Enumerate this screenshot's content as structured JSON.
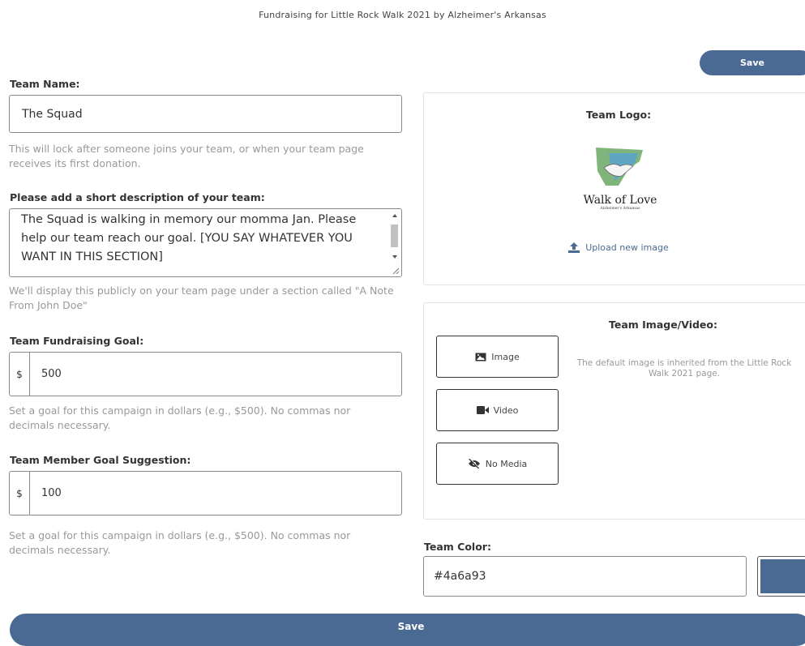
{
  "header": {
    "title": "Fundraising for Little Rock Walk 2021 by Alzheimer's Arkansas"
  },
  "actions": {
    "save_top": "Save",
    "save_bottom": "Save"
  },
  "team_name": {
    "label": "Team Name:",
    "value": "The Squad",
    "help": "This will lock after someone joins your team, or when your team page receives its first donation."
  },
  "description": {
    "label": "Please add a short description of your team:",
    "value": "The Squad is walking in memory our momma Jan. Please help our team reach our goal. [YOU SAY WHATEVER YOU WANT IN THIS SECTION]",
    "help": "We'll display this publicly on your team page under a section called \"A Note From John Doe\""
  },
  "fundraising_goal": {
    "label": "Team Fundraising Goal:",
    "currency": "$",
    "value": "500",
    "help": "Set a goal for this campaign in dollars (e.g., $500). No commas nor decimals necessary."
  },
  "member_goal": {
    "label": "Team Member Goal Suggestion:",
    "currency": "$",
    "value": "100",
    "help": "Set a goal for this campaign in dollars (e.g., $500). No commas nor decimals necessary."
  },
  "team_logo": {
    "label": "Team Logo:",
    "logo_title": "Walk of Love",
    "logo_subtitle": "Alzheimer's Arkansas",
    "upload_label": "Upload new image",
    "upload_icon": "upload-icon"
  },
  "team_media": {
    "label": "Team Image/Video:",
    "options": [
      {
        "label": "Image",
        "icon": "image-icon"
      },
      {
        "label": "Video",
        "icon": "video-icon"
      },
      {
        "label": "No Media",
        "icon": "eye-slash-icon"
      }
    ],
    "note": "The default image is inherited from the Little Rock Walk 2021 page."
  },
  "team_color": {
    "label": "Team Color:",
    "value": "#4a6a93",
    "swatch": "#4a6a93"
  },
  "colors": {
    "accent": "#4a6a93"
  }
}
